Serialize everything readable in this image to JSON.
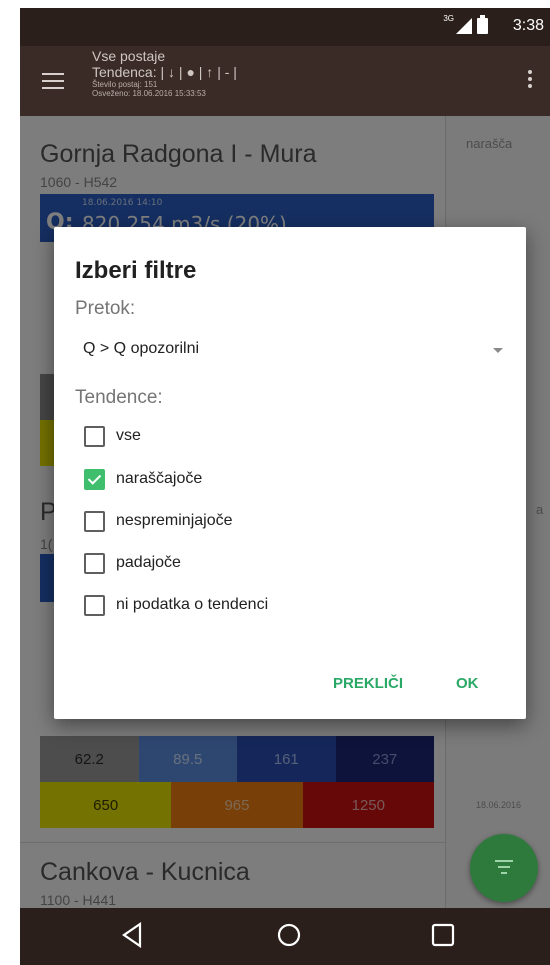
{
  "status_bar": {
    "network": "3G",
    "time": "3:38"
  },
  "app_bar": {
    "title": "Vse postaje",
    "tendency": "Tendenca: | ↓ | ● | ↑ | - |",
    "station_count": "Število postaj: 151",
    "updated": "Osveženo: 18.06.2016 15:33:53"
  },
  "stations": [
    {
      "name": "Gornja Radgona I - Mura",
      "code": "1060 - H542",
      "timestamp": "18.06.2016 14:10",
      "flow_prefix": "Q:",
      "flow_text": "820.254 m3/s (20%)",
      "side_text": "narašča"
    },
    {
      "name": "P",
      "code": "1(",
      "scale_top": [
        "62.2",
        "89.5",
        "161",
        "237"
      ],
      "scale_bottom": [
        "650",
        "965",
        "1250"
      ],
      "side_date": "18.06.2016",
      "side_text": "a"
    },
    {
      "name": "Cankova - Kucnica",
      "code": "1100 - H441"
    }
  ],
  "dialog": {
    "title": "Izberi filtre",
    "flow_label": "Pretok:",
    "flow_selected": "Q > Q opozorilni",
    "tendency_label": "Tendence:",
    "options": [
      {
        "label": "vse",
        "checked": false
      },
      {
        "label": "naraščajoče",
        "checked": true
      },
      {
        "label": "nespreminjajoče",
        "checked": false
      },
      {
        "label": "padajoče",
        "checked": false
      },
      {
        "label": "ni podatka o tendenci",
        "checked": false
      }
    ],
    "cancel_label": "PREKLIČI",
    "ok_label": "OK"
  },
  "colors": {
    "accent": "#3fbf6d",
    "button_text": "#2aa866",
    "app_bar": "#3a2b26",
    "fab": "#2e7a3d"
  }
}
